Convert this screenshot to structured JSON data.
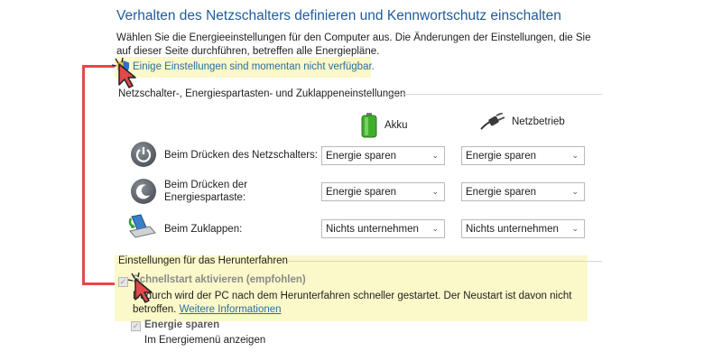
{
  "page": {
    "title": "Verhalten des Netzschalters definieren und Kennwortschutz einschalten",
    "intro": "Wählen Sie die Energieeinstellungen für den Computer aus. Die Änderungen der Einstellungen, die Sie auf dieser Seite durchführen, betreffen alle Energiepläne.",
    "notice_link": "Einige Einstellungen sind momentan nicht verfügbar."
  },
  "power_section": {
    "heading": "Netzschalter-, Energiespartasten- und Zuklappeneinstellungen",
    "col_battery": "Akku",
    "col_plugged": "Netzbetrieb",
    "rows": [
      {
        "label": "Beim Drücken des Netzschalters:",
        "battery": "Energie sparen",
        "plugged": "Energie sparen"
      },
      {
        "label": "Beim Drücken der Energiespartaste:",
        "label_line1": "Beim Drücken der",
        "label_line2": "Energiespartaste:",
        "battery": "Energie sparen",
        "plugged": "Energie sparen"
      },
      {
        "label": "Beim Zuklappen:",
        "battery": "Nichts unternehmen",
        "plugged": "Nichts unternehmen"
      }
    ]
  },
  "shutdown_section": {
    "heading": "Einstellungen für das Herunterfahren",
    "fast_startup_label": "Schnellstart aktivieren (empfohlen)",
    "fast_startup_desc": "Dadurch wird der PC nach dem Herunterfahren schneller gestartet. Der Neustart ist davon nicht betroffen.",
    "more_info_link": "Weitere Informationen",
    "sleep_label": "Energie sparen",
    "sleep_desc": "Im Energiemenü anzeigen"
  },
  "colors": {
    "title": "#1f5c9e",
    "link": "#2a6f9e",
    "highlight": "#fbf8c9",
    "annotation": "#e04a4a"
  }
}
